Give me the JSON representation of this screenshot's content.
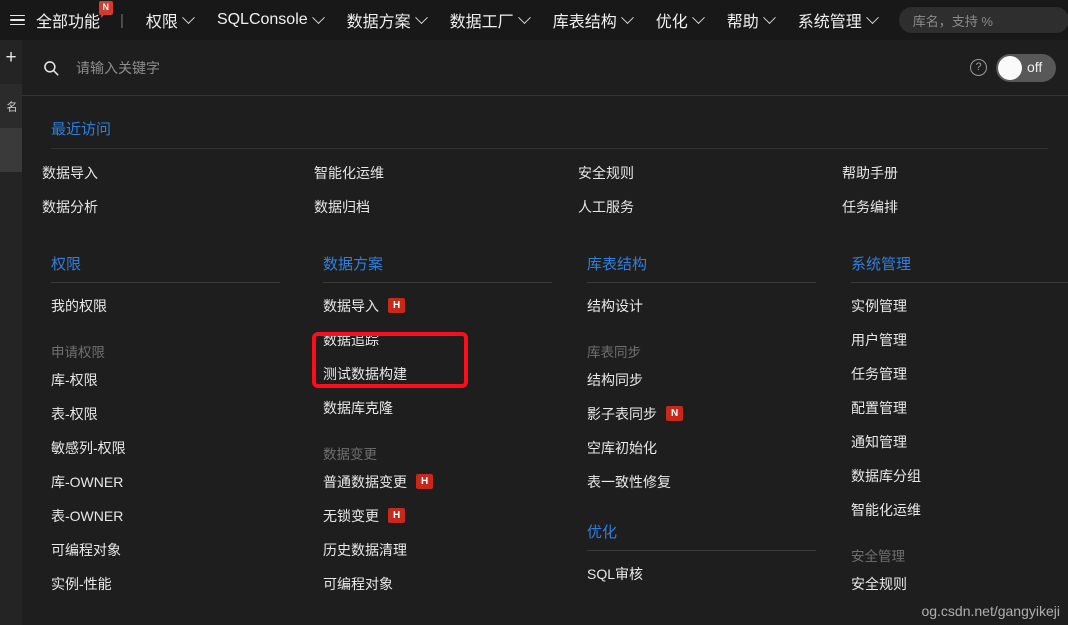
{
  "topnav": {
    "menu_icon": "hamburger-icon",
    "all_functions": "全部功能",
    "all_functions_badge": "N",
    "separator": "|",
    "items": [
      {
        "label": "权限"
      },
      {
        "label": "SQLConsole"
      },
      {
        "label": "数据方案"
      },
      {
        "label": "数据工厂"
      },
      {
        "label": "库表结构"
      },
      {
        "label": "优化"
      },
      {
        "label": "帮助"
      },
      {
        "label": "系统管理"
      }
    ],
    "search_placeholder": "库名，支持 %"
  },
  "left_rail": {
    "add_label": "+",
    "tab_label": "名"
  },
  "panel": {
    "search": {
      "icon": "search-icon",
      "value": "",
      "placeholder": "请输入关键字"
    },
    "help_icon": "question-icon",
    "toggle": {
      "label": "off",
      "state": "off"
    }
  },
  "recent": {
    "title": "最近访问",
    "links": [
      "数据导入",
      "智能化运维",
      "安全规则",
      "帮助手册",
      "数据分析",
      "数据归档",
      "人工服务",
      "任务编排"
    ]
  },
  "columns": [
    {
      "sections": [
        {
          "title": "权限",
          "items": [
            {
              "label": "我的权限"
            }
          ],
          "groups": [
            {
              "label": "申请权限",
              "items": [
                {
                  "label": "库-权限"
                },
                {
                  "label": "表-权限"
                },
                {
                  "label": "敏感列-权限"
                },
                {
                  "label": "库-OWNER"
                },
                {
                  "label": "表-OWNER"
                },
                {
                  "label": "可编程对象"
                },
                {
                  "label": "实例-性能"
                }
              ]
            }
          ]
        }
      ]
    },
    {
      "sections": [
        {
          "title": "数据方案",
          "items": [
            {
              "label": "数据导入",
              "tag": "H"
            },
            {
              "label": "数据追踪"
            },
            {
              "label": "测试数据构建"
            },
            {
              "label": "数据库克隆"
            }
          ],
          "groups": [
            {
              "label": "数据变更",
              "items": [
                {
                  "label": "普通数据变更",
                  "tag": "H"
                },
                {
                  "label": "无锁变更",
                  "tag": "H"
                },
                {
                  "label": "历史数据清理"
                },
                {
                  "label": "可编程对象"
                }
              ]
            }
          ]
        }
      ]
    },
    {
      "sections": [
        {
          "title": "库表结构",
          "items": [
            {
              "label": "结构设计"
            }
          ],
          "groups": [
            {
              "label": "库表同步",
              "items": [
                {
                  "label": "结构同步"
                },
                {
                  "label": "影子表同步",
                  "tag": "N"
                },
                {
                  "label": "空库初始化"
                },
                {
                  "label": "表一致性修复"
                }
              ]
            }
          ]
        },
        {
          "title": "优化",
          "items": [
            {
              "label": "SQL审核"
            }
          ],
          "groups": []
        }
      ]
    },
    {
      "sections": [
        {
          "title": "系统管理",
          "items": [
            {
              "label": "实例管理"
            },
            {
              "label": "用户管理"
            },
            {
              "label": "任务管理"
            },
            {
              "label": "配置管理"
            },
            {
              "label": "通知管理"
            },
            {
              "label": "数据库分组"
            },
            {
              "label": "智能化运维"
            }
          ],
          "groups": [
            {
              "label": "安全管理",
              "items": [
                {
                  "label": "安全规则"
                }
              ]
            }
          ]
        }
      ]
    }
  ],
  "annotation": {
    "highlight_target": "数据导入",
    "color": "#fc0d1b"
  },
  "watermark": "og.csdn.net/gangyikeji"
}
